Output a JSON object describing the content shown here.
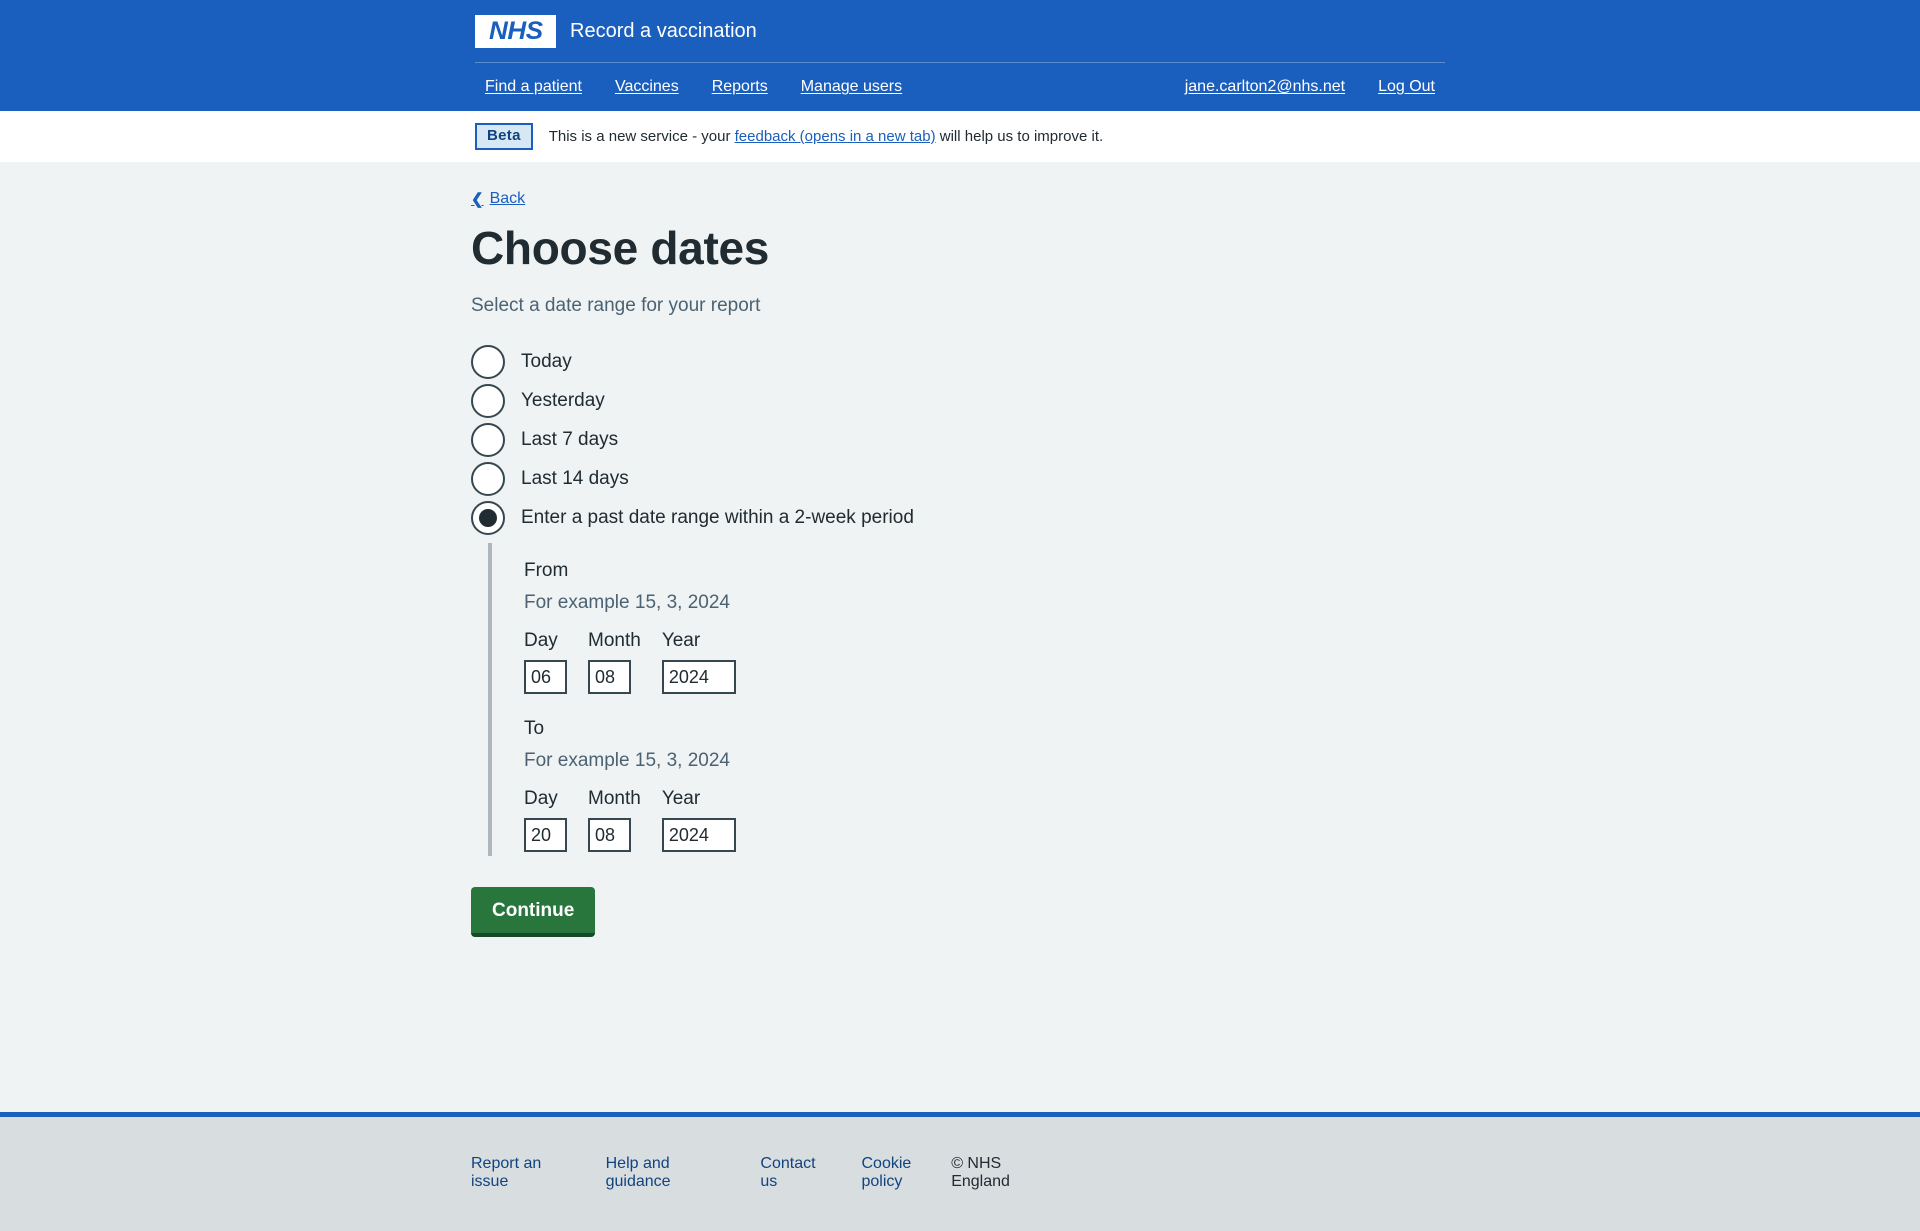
{
  "header": {
    "logo_text": "NHS",
    "service_name": "Record a vaccination",
    "nav_primary": [
      {
        "label": "Find a patient"
      },
      {
        "label": "Vaccines"
      },
      {
        "label": "Reports"
      },
      {
        "label": "Manage users"
      }
    ],
    "nav_account": [
      {
        "label": "jane.carlton2@nhs.net"
      },
      {
        "label": "Log Out"
      }
    ],
    "background_color": "#1a5fbd"
  },
  "beta_banner": {
    "tag": "Beta",
    "text_before": "This is a new service - your",
    "link_text": "feedback (opens in a new tab)",
    "text_after": "will help us to improve it."
  },
  "main": {
    "back_label": "Back",
    "back_chevron": "chevron-left-icon",
    "title": "Choose dates",
    "subtitle": "Select a date range for your report",
    "radio_options": [
      {
        "label": "Today",
        "selected": false
      },
      {
        "label": "Yesterday",
        "selected": false
      },
      {
        "label": "Last 7 days",
        "selected": false
      },
      {
        "label": "Last 14 days",
        "selected": false
      },
      {
        "label": "Enter a past date range within a 2-week period",
        "selected": true
      }
    ],
    "date_from": {
      "legend": "From",
      "hint": "For example 15, 3, 2024",
      "day_label": "Day",
      "month_label": "Month",
      "year_label": "Year",
      "day_value": "06",
      "month_value": "08",
      "year_value": "2024"
    },
    "date_to": {
      "legend": "To",
      "hint": "For example 15, 3, 2024",
      "day_label": "Day",
      "month_label": "Month",
      "year_label": "Year",
      "day_value": "20",
      "month_value": "08",
      "year_value": "2024"
    },
    "continue_label": "Continue",
    "continue_color": "#28763c"
  },
  "footer": {
    "links": [
      {
        "label": "Report an issue"
      },
      {
        "label": "Help and guidance"
      },
      {
        "label": "Contact us"
      },
      {
        "label": "Cookie policy"
      }
    ],
    "copyright": "© NHS England"
  }
}
